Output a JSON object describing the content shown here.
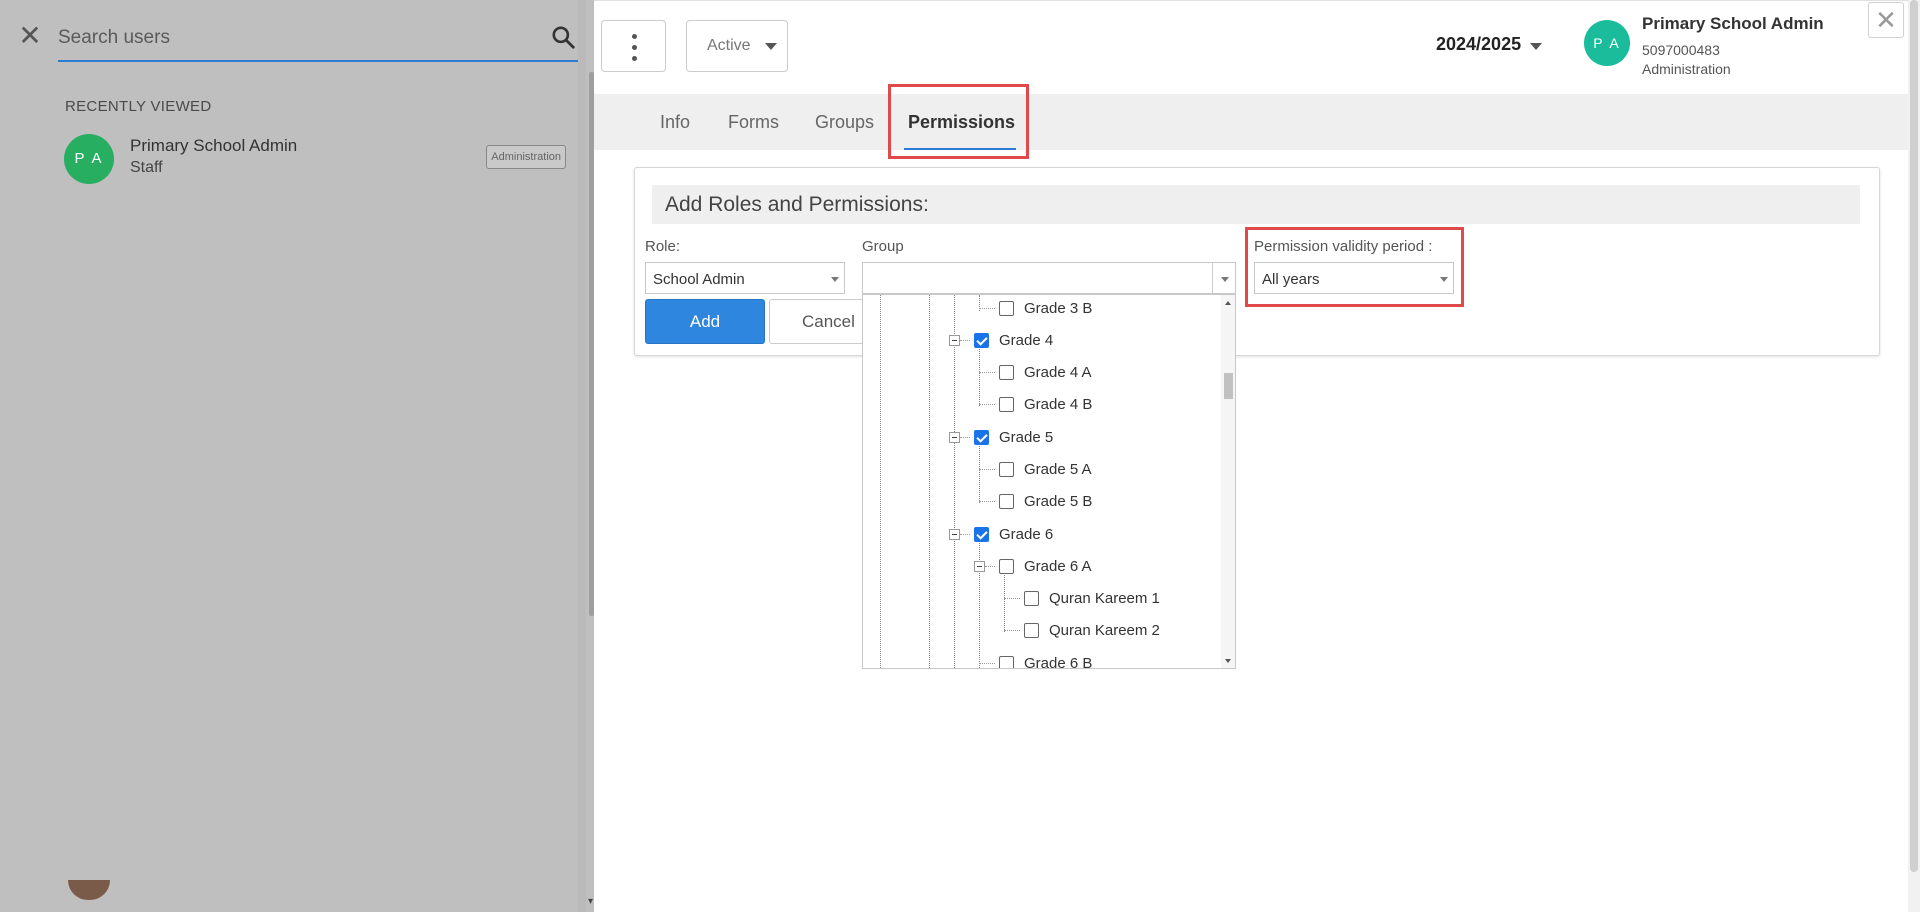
{
  "search": {
    "placeholder": "Search users"
  },
  "recent": {
    "heading": "RECENTLY VIEWED",
    "items": [
      {
        "initials": "P A",
        "name": "Primary School Admin",
        "role": "Staff",
        "badge": "Administration"
      }
    ]
  },
  "header": {
    "status": "Active",
    "year": "2024/2025",
    "profile": {
      "initials": "P A",
      "name": "Primary School Admin",
      "id": "5097000483",
      "department": "Administration"
    }
  },
  "tabs": [
    "Info",
    "Forms",
    "Groups",
    "Permissions"
  ],
  "active_tab": "Permissions",
  "form": {
    "title": "Add Roles and Permissions:",
    "role_label": "Role:",
    "role_value": "School Admin",
    "group_label": "Group",
    "group_value": "",
    "validity_label": "Permission validity period :",
    "validity_value": "All years",
    "add_label": "Add",
    "cancel_label": "Cancel"
  },
  "tree": [
    {
      "label": "Grade 3 B",
      "level": 2,
      "checked": false
    },
    {
      "label": "Grade 4",
      "level": 1,
      "checked": true,
      "expanded": true
    },
    {
      "label": "Grade 4 A",
      "level": 2,
      "checked": false
    },
    {
      "label": "Grade 4 B",
      "level": 2,
      "checked": false
    },
    {
      "label": "Grade 5",
      "level": 1,
      "checked": true,
      "expanded": true
    },
    {
      "label": "Grade 5 A",
      "level": 2,
      "checked": false
    },
    {
      "label": "Grade 5 B",
      "level": 2,
      "checked": false
    },
    {
      "label": "Grade 6",
      "level": 1,
      "checked": true,
      "expanded": true
    },
    {
      "label": "Grade 6 A",
      "level": 2,
      "checked": false,
      "expanded": true
    },
    {
      "label": "Quran Kareem 1",
      "level": 3,
      "checked": false
    },
    {
      "label": "Quran Kareem 2",
      "level": 3,
      "checked": false
    },
    {
      "label": "Grade 6 B",
      "level": 2,
      "checked": false
    }
  ],
  "colors": {
    "accent": "#2e86de",
    "highlight": "#e04a4a",
    "avatar_recent": "#27ae60",
    "avatar_profile": "#1abc9c"
  }
}
